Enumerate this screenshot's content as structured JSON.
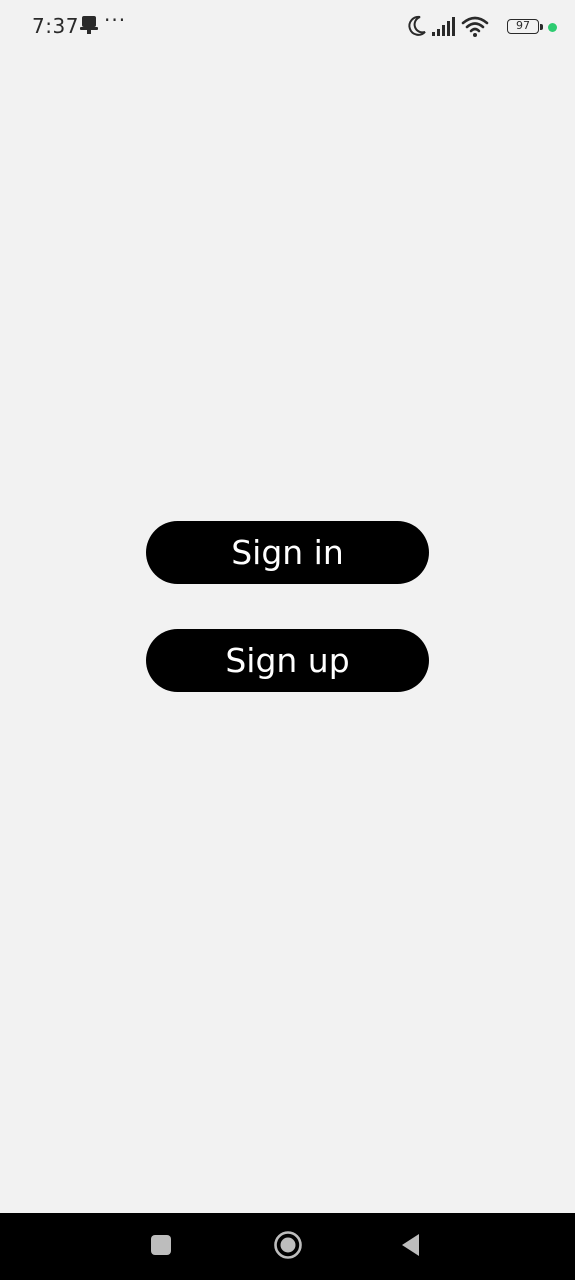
{
  "status_bar": {
    "time": "7:37",
    "more": "···",
    "battery_level": "97",
    "notification_icon": "notification-icon",
    "dnd_icon": "moon-icon",
    "signal_icon": "signal-icon",
    "wifi_icon": "wifi-icon",
    "dot_color": "#2ecc71"
  },
  "auth": {
    "sign_in_label": "Sign in",
    "sign_up_label": "Sign up"
  },
  "nav_bar": {
    "recent_icon": "recent-apps-icon",
    "home_icon": "home-icon",
    "back_icon": "back-icon"
  }
}
